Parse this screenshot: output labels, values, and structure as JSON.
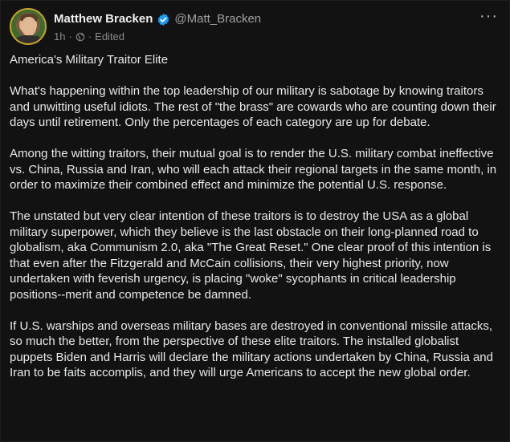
{
  "author": {
    "name": "Matthew Bracken",
    "handle": "@Matt_Bracken",
    "time": "1h",
    "edited": "Edited"
  },
  "icons": {
    "verified": "verified-badge-icon",
    "visibility": "globe-icon",
    "more": "more-options-icon"
  },
  "colors": {
    "background": "#121212",
    "verified_blue": "#1d9bf0",
    "text": "#e7e9ea",
    "muted": "#8b8b8b"
  },
  "post": {
    "title": "America's Military Traitor Elite",
    "paragraphs": [
      "What's happening within the top leadership of our military is sabotage by knowing traitors and unwitting useful idiots. The rest of \"the brass\" are cowards who are counting down their days until retirement. Only the percentages of each category are up for debate.",
      "Among the witting traitors, their mutual goal is to render the U.S. military combat ineffective vs. China, Russia and Iran, who will each attack their regional targets in the same month, in order to maximize their combined effect and minimize the potential U.S. response.",
      "The unstated but very clear intention of these traitors is to destroy the USA as a global military superpower, which they believe is the last obstacle on their long-planned road to globalism, aka Communism 2.0, aka \"The Great Reset.\" One clear proof of this intention is that even after the Fitzgerald and McCain collisions, their very highest priority, now undertaken with feverish urgency, is placing \"woke\" sycophants in critical leadership positions--merit and competence be damned.",
      "If U.S. warships and overseas military bases are destroyed in conventional missile attacks, so much the better, from the perspective of these elite traitors. The installed globalist puppets Biden and Harris will declare the military actions undertaken by China, Russia and Iran to be faits accomplis, and they will urge Americans to accept the new global order."
    ]
  }
}
